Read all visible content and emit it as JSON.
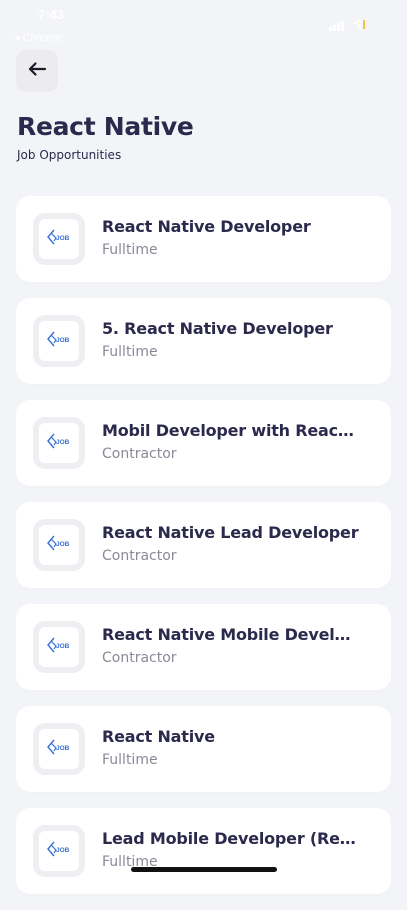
{
  "status_bar": {
    "time": "7:43",
    "back_app": "◂ Chrome",
    "battery_color": "#f3c14c"
  },
  "header": {
    "back_icon": "arrow-left-icon",
    "title": "React Native",
    "subtitle": "Job Opportunities"
  },
  "jobs": [
    {
      "title": "React Native Developer",
      "type": "Fulltime",
      "logo": "job-logo-icon"
    },
    {
      "title": "5. React Native Developer",
      "type": "Fulltime",
      "logo": "job-logo-icon"
    },
    {
      "title": "Mobil Developer with React Native",
      "type": "Contractor",
      "logo": "job-logo-icon"
    },
    {
      "title": "React Native Lead Developer",
      "type": "Contractor",
      "logo": "job-logo-icon"
    },
    {
      "title": "React Native Mobile Developer",
      "type": "Contractor",
      "logo": "job-logo-icon"
    },
    {
      "title": "React Native",
      "type": "Fulltime",
      "logo": "job-logo-icon"
    },
    {
      "title": "Lead Mobile Developer (React Native)",
      "type": "Fulltime",
      "logo": "job-logo-icon"
    }
  ],
  "colors": {
    "background": "#f3f4f8",
    "card": "#ffffff",
    "title_text": "#2b2a4c",
    "muted_text": "#8a8a98",
    "logo_blue": "#3a6fd8"
  }
}
